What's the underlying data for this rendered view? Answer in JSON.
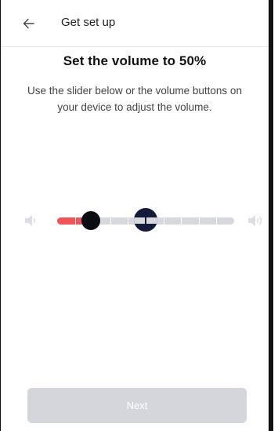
{
  "header": {
    "title": "Get set up",
    "back_icon": "arrow-left-icon"
  },
  "main": {
    "title": "Set the volume to 50%",
    "subtitle": "Use the slider below or the volume buttons on your device to adjust the volume.",
    "volume_low_icon": "speaker-low-icon",
    "volume_high_icon": "speaker-high-icon"
  },
  "slider": {
    "current_fraction": 0.19,
    "target_fraction": 0.5,
    "segments": 10,
    "fill_color": "#f2545b",
    "track_color": "#d7d8dd",
    "thumb_color": "#0c0c14",
    "target_color": "#141a3a"
  },
  "footer": {
    "next_label": "Next",
    "next_enabled": false,
    "button_color": "#d5d6db"
  }
}
